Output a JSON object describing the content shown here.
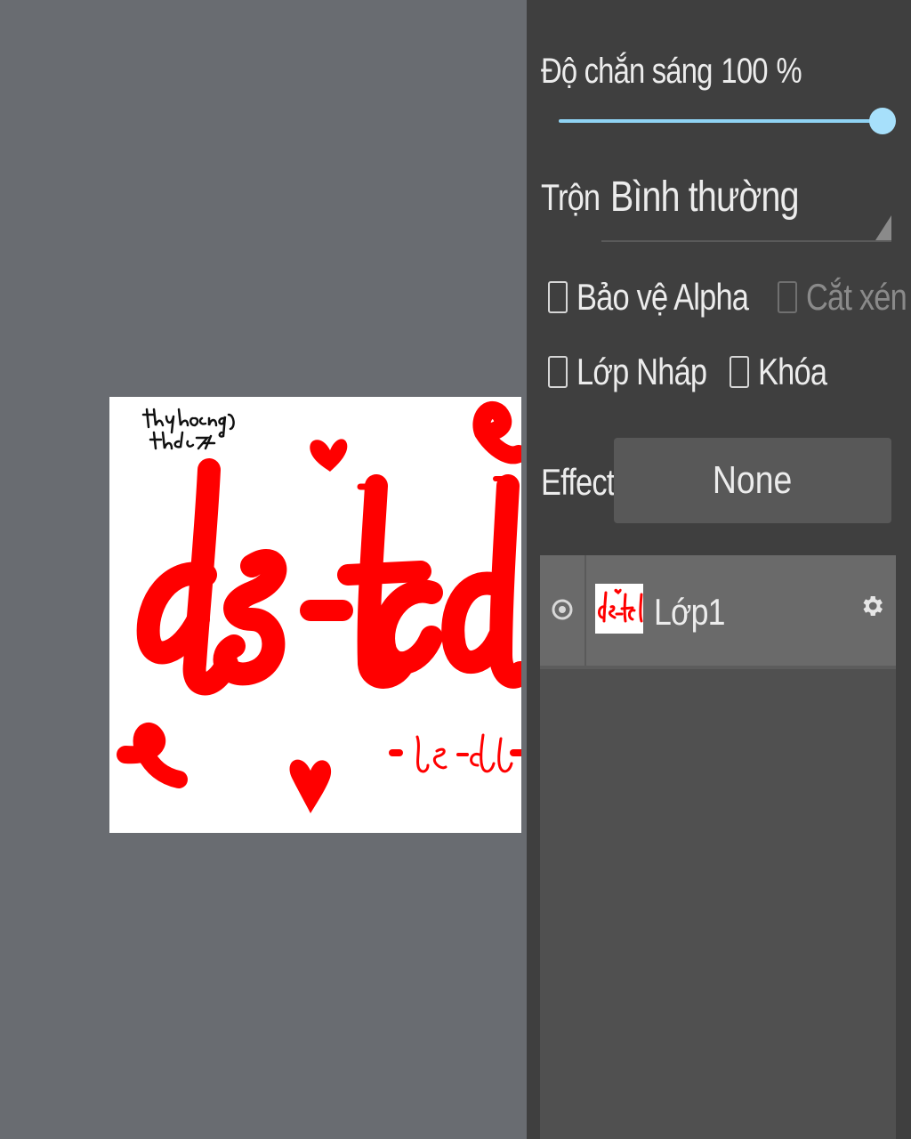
{
  "properties": {
    "opacity_label": "Độ chắn sáng",
    "opacity_value": "100",
    "opacity_unit": "%",
    "opacity_level": 1.0,
    "blend_label": "Trộn",
    "blend_value": "Bình thường",
    "checkboxes": {
      "protect_alpha": "Bảo vệ Alpha",
      "clipping": "Cắt xén",
      "draft_layer": "Lớp Nháp",
      "lock": "Khóa"
    },
    "effect_label": "Effect",
    "effect_value": "None"
  },
  "layers": [
    {
      "name": "Lớp1",
      "visible": true
    }
  ],
  "colors": {
    "canvas_bg": "#696c71",
    "panel_bg": "#3f3f3f",
    "accent": "#8fd3f4",
    "ink": "#ff0000"
  }
}
